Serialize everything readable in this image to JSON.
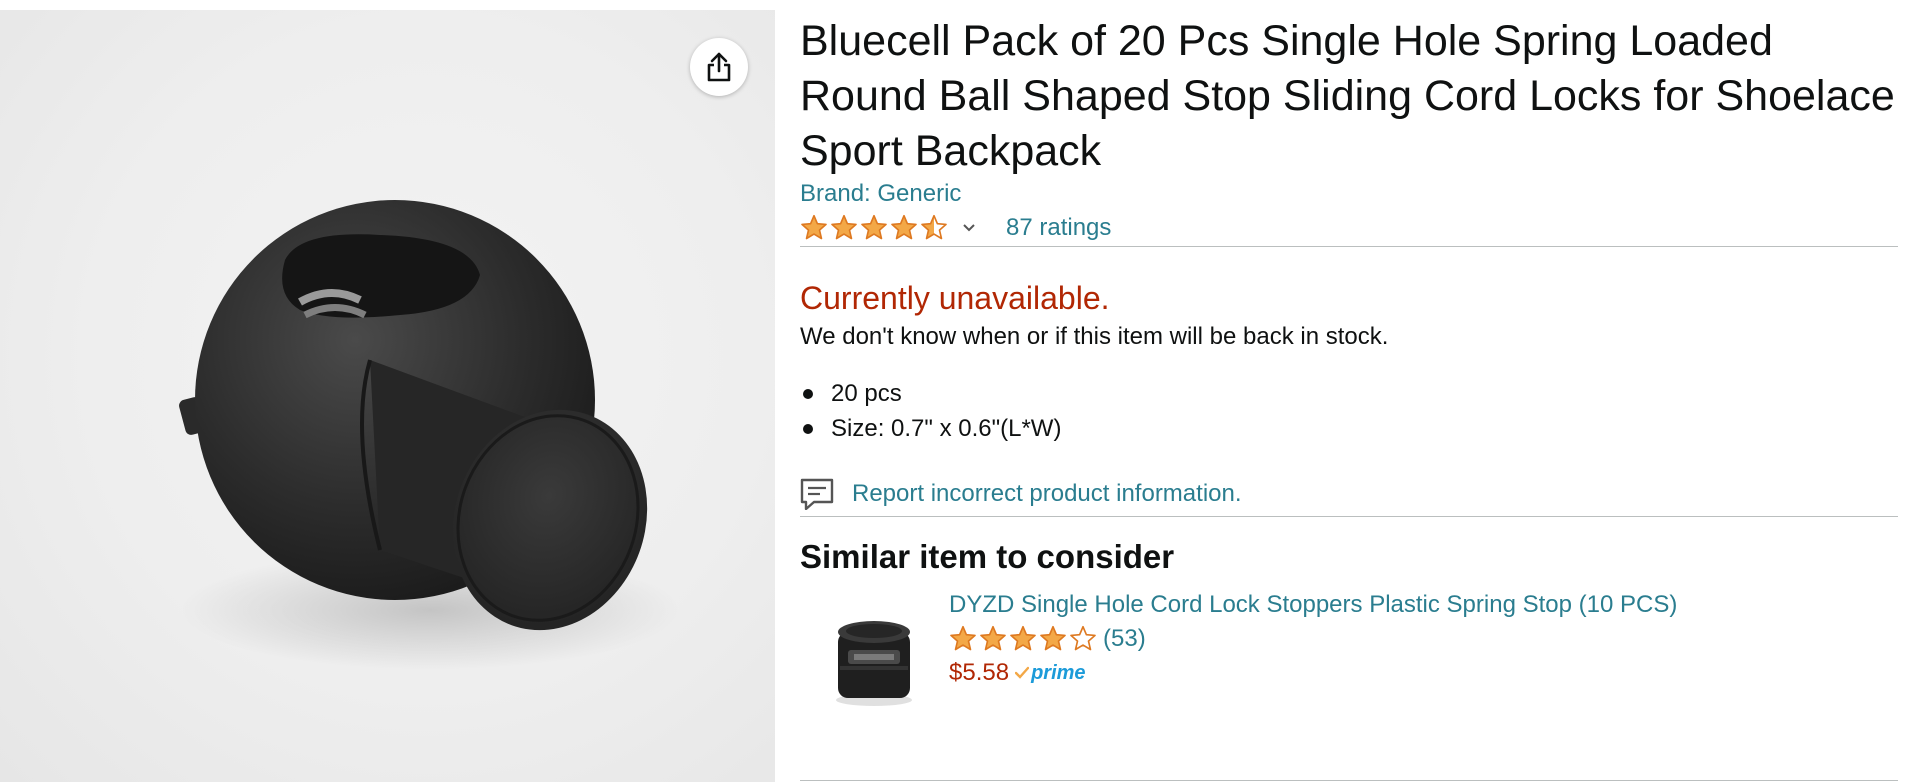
{
  "product": {
    "title": "Bluecell Pack of 20 Pcs Single Hole Spring Loaded Round Ball Shaped Stop Sliding Cord Locks for Shoelace Sport Backpack",
    "brand": "Brand: Generic",
    "rating": 4.5,
    "ratings_count": "87 ratings",
    "availability": "Currently unavailable.",
    "stock_note": "We don't know when or if this item will be back in stock.",
    "bullets": [
      "20 pcs",
      "Size: 0.7\" x 0.6\"(L*W)"
    ],
    "report_label": "Report incorrect product information."
  },
  "similar": {
    "heading": "Similar item to consider",
    "title": "DYZD Single Hole Cord Lock Stoppers Plastic Spring Stop (10 PCS)",
    "rating": 4.0,
    "count": "(53)",
    "price": "$5.58",
    "prime": "prime"
  },
  "icons": {
    "share": "share-icon",
    "chevron": "chevron-down-icon",
    "report": "comment-report-icon",
    "star": "star-icon",
    "prime_check": "prime-check-icon"
  },
  "colors": {
    "link": "#2a7d8f",
    "unavailable": "#b12704",
    "star": "#f3a847",
    "prime": "#1c9bd9"
  }
}
